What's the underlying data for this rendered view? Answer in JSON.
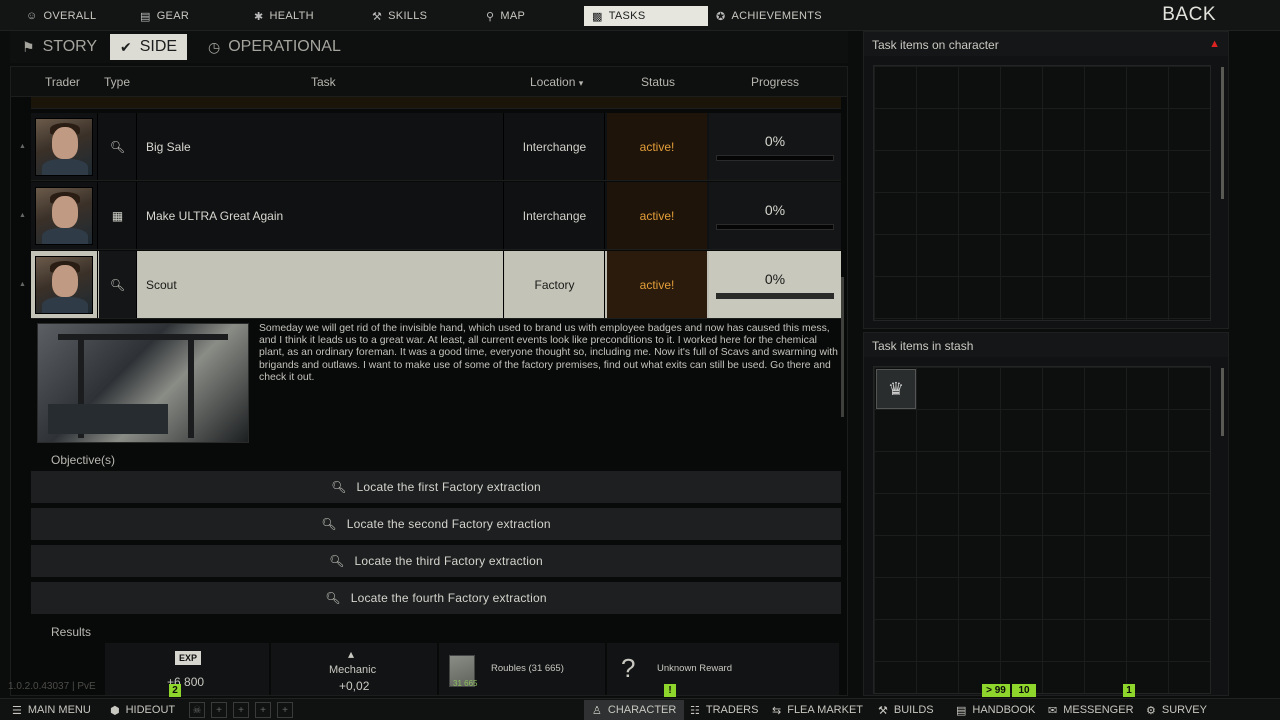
{
  "topnav": {
    "tabs": [
      {
        "label": "OVERALL",
        "icon": "person-icon"
      },
      {
        "label": "GEAR",
        "icon": "shirt-icon"
      },
      {
        "label": "HEALTH",
        "icon": "health-icon"
      },
      {
        "label": "SKILLS",
        "icon": "skills-icon"
      },
      {
        "label": "MAP",
        "icon": "map-pin-icon"
      },
      {
        "label": "TASKS",
        "icon": "tasks-icon",
        "active": true
      },
      {
        "label": "ACHIEVEMENTS",
        "icon": "achievements-icon"
      }
    ],
    "back_label": "BACK"
  },
  "subtabs": [
    {
      "label": "STORY",
      "icon": "story-icon"
    },
    {
      "label": "SIDE",
      "icon": "side-icon",
      "active": true
    },
    {
      "label": "OPERATIONAL",
      "icon": "clock-icon"
    }
  ],
  "columns": {
    "trader": "Trader",
    "type": "Type",
    "task": "Task",
    "location": "Location",
    "status": "Status",
    "progress": "Progress"
  },
  "tasks": [
    {
      "name": "Big Sale",
      "location": "Interchange",
      "status": "active!",
      "progress": "0%",
      "progress_fraction": 0.0,
      "type_icon": "search-icon"
    },
    {
      "name": "Make ULTRA Great Again",
      "location": "Interchange",
      "status": "active!",
      "progress": "0%",
      "progress_fraction": 0.0,
      "type_icon": "map-icon"
    },
    {
      "name": "Scout",
      "location": "Factory",
      "status": "active!",
      "progress": "0%",
      "progress_fraction": 0.0,
      "type_icon": "search-icon",
      "selected": true
    }
  ],
  "description": "Someday we will get rid of the invisible hand, which used to brand us with employee badges and now has caused this mess, and I think it leads us to a great war. At least, all current events look like preconditions to it. I worked here for the chemical plant, as an ordinary foreman. It was a good time, everyone thought so, including me. Now it's full of Scavs and swarming with brigands and outlaws. I want to make use of some of the factory premises, find out what exits can still be used. Go there and check it out.",
  "objectives_label": "Objective(s)",
  "objectives": [
    "Locate the first Factory extraction",
    "Locate the second Factory extraction",
    "Locate the third Factory extraction",
    "Locate the fourth Factory extraction"
  ],
  "results_label": "Results",
  "rewards": {
    "exp_badge": "EXP",
    "exp_value": "+6 800",
    "standing_name": "Mechanic",
    "standing_value": "+0,02",
    "roubles_label": "Roubles (31 665)",
    "roubles_small": "31 665",
    "unknown_label": "Unknown Reward",
    "unknown_icon": "?"
  },
  "side": {
    "on_character_title": "Task items on character",
    "in_stash_title": "Task items in stash",
    "stash_item_icon": "badge-icon"
  },
  "bottombar": {
    "main_menu": "MAIN MENU",
    "hideout": "HIDEOUT",
    "character": "CHARACTER",
    "traders": "TRADERS",
    "flea_market": "FLEA MARKET",
    "builds": "BUILDS",
    "handbook": "HANDBOOK",
    "messenger": "MESSENGER",
    "survey": "SURVEY"
  },
  "notifications": {
    "hideout_badge": "2",
    "character_badge": "!",
    "handbook_badge_a": "> 99",
    "handbook_badge_b": "10",
    "messenger_badge": "1"
  },
  "version": "1.0.2.0.43037 | PvE",
  "colors": {
    "status_active": "#e39e3a",
    "notif_green": "#8ed52c",
    "warning_red": "#dd2222"
  }
}
